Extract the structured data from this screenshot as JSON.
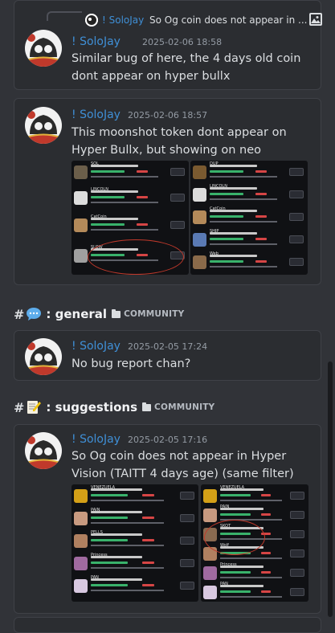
{
  "messages": [
    {
      "reply": {
        "author": "! SoloJay",
        "text": "So Og coin does not appear in ..."
      },
      "author": "! SoloJay",
      "timestamp": "2025-02-06 18:58",
      "text": "Similar bug of here, the 4 days old coin dont appear on hyper bullx"
    },
    {
      "author": "! SoloJay",
      "timestamp": "2025-02-06 18:57",
      "text": "This moonshot token dont appear on Hyper Bullx, but showing on neo",
      "attachments": {
        "left_labels": [
          "SOL",
          "LINCOLN",
          "CatCoin",
          "SLOW"
        ],
        "right_labels": [
          "DUP",
          "LINCOLN",
          "CatCoin",
          "SHIP",
          "Web"
        ]
      }
    },
    {
      "channel": {
        "hash": "#",
        "name": ": general",
        "category": "COMMUNITY",
        "emoji_icon": "speech-bubble-icon"
      },
      "author": "! SoloJay",
      "timestamp": "2025-02-05 17:24",
      "text": "No bug report chan?"
    },
    {
      "channel": {
        "hash": "#",
        "name": ": suggestions",
        "category": "COMMUNITY",
        "emoji_icon": "memo-icon"
      },
      "author": "! SoloJay",
      "timestamp": "2025-02-05 17:16",
      "text": "So Og coin does not appear in Hyper Vision (TAITT 4 days age) (same filter)",
      "attachments": {
        "left_labels": [
          "VENEZUELA",
          "PAIN",
          "PELLS",
          "Princess",
          "PAN"
        ],
        "right_labels": [
          "VENEZUELA",
          "PAIN",
          "SKOT",
          "Wolf",
          "Princess",
          "PAN"
        ]
      }
    }
  ],
  "colors": {
    "background": "#313338",
    "card": "#2b2d31",
    "author": "#3f8fd6",
    "highlight_circle": "#c0392b"
  }
}
